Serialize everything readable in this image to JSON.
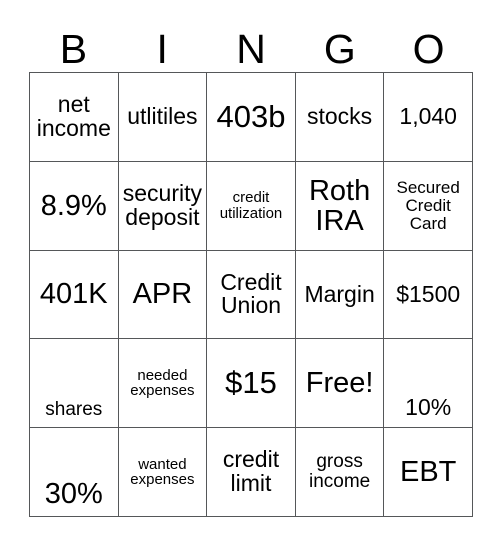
{
  "card": {
    "title": "BINGO",
    "header": {
      "letters": [
        "B",
        "I",
        "N",
        "G",
        "O"
      ]
    },
    "colors": {
      "border": "#555759",
      "text": "#000000",
      "background": "#ffffff"
    },
    "grid": {
      "rows": 5,
      "columns": 5,
      "cells": [
        [
          {
            "text": "net income",
            "size": "md",
            "align": "center"
          },
          {
            "text": "utlitiles",
            "size": "md",
            "align": "center"
          },
          {
            "text": "403b",
            "size": "xl",
            "align": "center"
          },
          {
            "text": "stocks",
            "size": "md",
            "align": "center"
          },
          {
            "text": "1,040",
            "size": "md",
            "align": "center"
          }
        ],
        [
          {
            "text": "8.9%",
            "size": "lg",
            "align": "center"
          },
          {
            "text": "security deposit",
            "size": "md",
            "align": "center"
          },
          {
            "text": "credit utilization",
            "size": "xxs",
            "align": "center"
          },
          {
            "text": "Roth IRA",
            "size": "lg",
            "align": "center"
          },
          {
            "text": "Secured Credit Card",
            "size": "xs",
            "align": "center"
          }
        ],
        [
          {
            "text": "401K",
            "size": "lg",
            "align": "center"
          },
          {
            "text": "APR",
            "size": "lg",
            "align": "center"
          },
          {
            "text": "Credit Union",
            "size": "md",
            "align": "center"
          },
          {
            "text": "Margin",
            "size": "md",
            "align": "center"
          },
          {
            "text": "$1500",
            "size": "md",
            "align": "center"
          }
        ],
        [
          {
            "text": "shares",
            "size": "sm",
            "align": "bottom"
          },
          {
            "text": "needed expenses",
            "size": "xxs",
            "align": "center"
          },
          {
            "text": "$15",
            "size": "xl",
            "align": "center"
          },
          {
            "text": "Free!",
            "size": "lg",
            "align": "center"
          },
          {
            "text": "10%",
            "size": "md",
            "align": "bottom"
          }
        ],
        [
          {
            "text": "30%",
            "size": "lg",
            "align": "bottom"
          },
          {
            "text": "wanted expenses",
            "size": "xxs",
            "align": "center"
          },
          {
            "text": "credit limit",
            "size": "md",
            "align": "center"
          },
          {
            "text": "gross income",
            "size": "sm",
            "align": "center"
          },
          {
            "text": "EBT",
            "size": "lg",
            "align": "center"
          }
        ]
      ]
    }
  }
}
